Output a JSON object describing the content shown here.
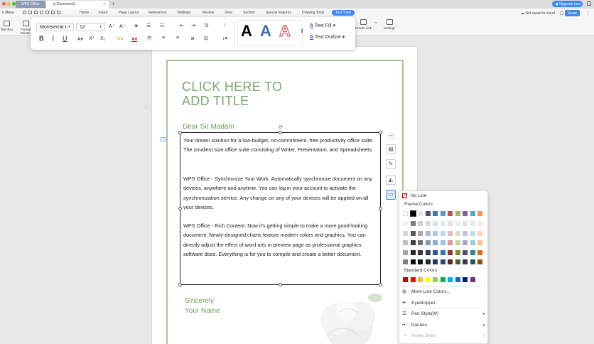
{
  "titlebar": {
    "tab_app": "WPS Office",
    "tab_doc": "Document1",
    "new_tab": "+",
    "upgrade": "Upgrade now",
    "traffic": [
      "#ff5f57",
      "#febc2e",
      "#28c840"
    ]
  },
  "ribbon": {
    "menu": "Menu",
    "tabs": [
      "Home",
      "Insert",
      "Page Layout",
      "References",
      "Mailings",
      "Review",
      "View",
      "Section",
      "Special features",
      "Drawing Tools",
      "Text Tools"
    ],
    "active_tab": "Text Tools",
    "tools": [
      "Text Box",
      "Format Painter",
      "Create Link",
      "Settings"
    ],
    "status": "Not saved to cloud",
    "share": "Share"
  },
  "text_toolbar": {
    "font": "Montserrat L",
    "size": "12",
    "text_fill": "Text Fill",
    "text_outline": "Text Outline",
    "styles": [
      "A",
      "A",
      "A"
    ],
    "accent": "#3d8af7"
  },
  "document": {
    "title_line1": "CLICK HERE TO",
    "title_line2": "ADD TITLE",
    "greeting": "Dear Sir Madam",
    "para1": "Your dream solution for a low-budget, no-commitment, free productivity office suite. The smallest size office suite consisting of Writer, Presentation, and Spreadsheets.",
    "para2": "WPS Office - Synchronize Your Work.  Automatically synchronize document on any devices, anywhere and anytime. You can log in your account to activate the synchronization service. Any change on any of your devices will be applied on all your devices.",
    "para3": "WPS Office - Rich Content.  Now it's getting simple to make a more good-looking document. Newly-designed charts feature modern colors and graphics. You can directly adjust the effect of word arts in preview page as professional graphics software does. Everything is for you to compile and create a better document.",
    "closing1": "Sincerely",
    "closing2": "Your Name",
    "accent_green": "#79a86a"
  },
  "line_panel": {
    "no_line": "No Line",
    "theme_colors": "Theme Colors",
    "standard_colors": "Standard Colors",
    "more_line_colors": "More Line Colors...",
    "eyedropper": "Eyedropper",
    "pen_style": "Pen Style(W)",
    "dashes": "Dashes",
    "arrow_style": "Arrow Style",
    "theme_top": [
      "#ffffff",
      "#000000",
      "#e7e6e6",
      "#44546a",
      "#4472c4",
      "#5b9bd5",
      "#c0504d",
      "#9bbb59",
      "#8064a2",
      "#4bacc6",
      "#f79646"
    ],
    "theme_rows": [
      [
        "#f2f2f2",
        "#7f7f7f",
        "#d0cece",
        "#d6dce4",
        "#d9e2f3",
        "#deebf6",
        "#f2dcdb",
        "#ebf1dd",
        "#e5e0ec",
        "#dbeef3",
        "#fde9d9"
      ],
      [
        "#d8d8d8",
        "#595959",
        "#aeabab",
        "#adb9ca",
        "#b4c6e7",
        "#bdd7ee",
        "#e6b8b7",
        "#d7e3bc",
        "#ccc1d9",
        "#b7dde8",
        "#fbd5b5"
      ],
      [
        "#bfbfbf",
        "#3f3f3f",
        "#757070",
        "#8496b0",
        "#8eaadb",
        "#9dc3e6",
        "#d99694",
        "#c3d69b",
        "#b2a2c7",
        "#92cddc",
        "#fac08f"
      ],
      [
        "#a5a5a5",
        "#262626",
        "#3a3838",
        "#323f4f",
        "#2f5496",
        "#2e75b5",
        "#953734",
        "#76923c",
        "#5f497a",
        "#31859b",
        "#e36c09"
      ],
      [
        "#7f7f7f",
        "#0c0c0c",
        "#171616",
        "#222a35",
        "#1f3864",
        "#1e4e79",
        "#632423",
        "#4f6128",
        "#3f3151",
        "#205867",
        "#974806"
      ]
    ],
    "standard": [
      "#c00000",
      "#ff0000",
      "#ffc000",
      "#ffff00",
      "#92d050",
      "#00b050",
      "#00b0f0",
      "#0070c0",
      "#002060",
      "#7030a0"
    ]
  }
}
